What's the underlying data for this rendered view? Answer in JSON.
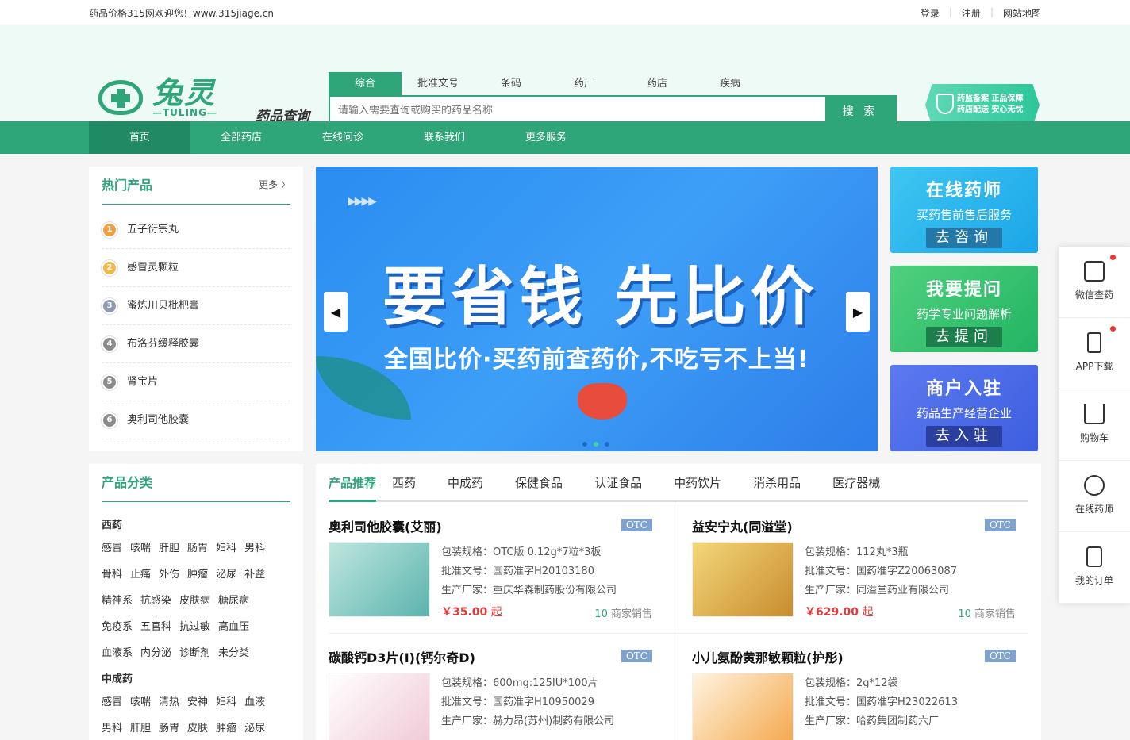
{
  "topbar": {
    "welcome": "药品价格315网欢迎您！www.315jiage.cn",
    "login": "登录",
    "register": "注册",
    "sitemap": "网站地图"
  },
  "logo": {
    "cn": "兔灵",
    "en": "—TULING—"
  },
  "query_label": "药品查询",
  "search": {
    "tabs": [
      "综合",
      "批准文号",
      "条码",
      "药厂",
      "药店",
      "疾病"
    ],
    "active_tab": 0,
    "placeholder": "请输入需要查询或购买的药品名称",
    "button": "搜 索"
  },
  "badge": {
    "line1": "药监备案 正品保障",
    "line2": "药店配送 安心无忧"
  },
  "nav": [
    "首页",
    "全部药店",
    "在线问诊",
    "联系我们",
    "更多服务"
  ],
  "hot": {
    "title": "热门产品",
    "more": "更多 〉",
    "items": [
      {
        "rank": "1",
        "name": "五子衍宗丸",
        "color": "#f0a040"
      },
      {
        "rank": "2",
        "name": "感冒灵颗粒",
        "color": "#f2b84b"
      },
      {
        "rank": "3",
        "name": "蜜炼川贝枇杷膏",
        "color": "#8f9bb3"
      },
      {
        "rank": "4",
        "name": "布洛芬缓释胶囊",
        "color": "#8c8c8c"
      },
      {
        "rank": "5",
        "name": "肾宝片",
        "color": "#8c8c8c"
      },
      {
        "rank": "6",
        "name": "奥利司他胶囊",
        "color": "#8c8c8c"
      }
    ]
  },
  "banner": {
    "title": "要省钱 先比价",
    "sub": "全国比价·买药前查药价,不吃亏不上当!"
  },
  "side_cards": [
    {
      "title": "在线药师",
      "sub": "买药售前售后服务",
      "btn": "去咨询"
    },
    {
      "title": "我要提问",
      "sub": "药学专业问题解析",
      "btn": "去提问"
    },
    {
      "title": "商户入驻",
      "sub": "药品生产经营企业",
      "btn": "去入驻"
    }
  ],
  "categories": {
    "title": "产品分类",
    "groups": [
      {
        "name": "西药",
        "rows": [
          [
            "感冒",
            "咳喘",
            "肝胆",
            "肠胃",
            "妇科",
            "男科"
          ],
          [
            "骨科",
            "止痛",
            "外伤",
            "肿瘤",
            "泌尿",
            "补益"
          ],
          [
            "精神系",
            "抗感染",
            "皮肤病",
            "糖尿病"
          ],
          [
            "免疫系",
            "五官科",
            "抗过敏",
            "高血压"
          ],
          [
            "血液系",
            "内分泌",
            "诊断剂",
            "未分类"
          ]
        ]
      },
      {
        "name": "中成药",
        "rows": [
          [
            "感冒",
            "咳喘",
            "清热",
            "安神",
            "妇科",
            "血液"
          ],
          [
            "男科",
            "肝胆",
            "肠胃",
            "皮肤",
            "肿瘤",
            "泌尿"
          ]
        ]
      }
    ]
  },
  "product_tabs": [
    "产品推荐",
    "西药",
    "中成药",
    "保健食品",
    "认证食品",
    "中药饮片",
    "消杀用品",
    "医疗器械"
  ],
  "products": [
    {
      "name": "奥利司他胶囊(艾丽)",
      "otc": "OTC",
      "spec_label": "包装规格：",
      "spec": "OTC版 0.12g*7粒*3板",
      "approval_label": "批准文号：",
      "approval": "国药准字H20103180",
      "maker_label": "生产厂家：",
      "maker": "重庆华森制药股份有限公司",
      "price": "￥35.00",
      "price_suffix": " 起",
      "shops": "10",
      "shops_suffix": " 商家销售"
    },
    {
      "name": "益安宁丸(同溢堂)",
      "otc": "OTC",
      "spec_label": "包装规格：",
      "spec": "112丸*3瓶",
      "approval_label": "批准文号：",
      "approval": "国药准字Z20063087",
      "maker_label": "生产厂家：",
      "maker": "同溢堂药业有限公司",
      "price": "￥629.00",
      "price_suffix": " 起",
      "shops": "10",
      "shops_suffix": " 商家销售"
    },
    {
      "name": "碳酸钙D3片(Ⅰ)(钙尔奇D)",
      "otc": "OTC",
      "spec_label": "包装规格：",
      "spec": "600mg:125IU*100片",
      "approval_label": "批准文号：",
      "approval": "国药准字H10950029",
      "maker_label": "生产厂家：",
      "maker": "赫力昂(苏州)制药有限公司",
      "price": "",
      "price_suffix": "",
      "shops": "",
      "shops_suffix": ""
    },
    {
      "name": "小儿氨酚黄那敏颗粒(护彤)",
      "otc": "OTC",
      "spec_label": "包装规格：",
      "spec": "2g*12袋",
      "approval_label": "批准文号：",
      "approval": "国药准字H23022613",
      "maker_label": "生产厂家：",
      "maker": "哈药集团制药六厂",
      "price": "",
      "price_suffix": "",
      "shops": "",
      "shops_suffix": ""
    }
  ],
  "floatbar": [
    "微信查药",
    "APP下载",
    "购物车",
    "在线药师",
    "我的订单"
  ]
}
